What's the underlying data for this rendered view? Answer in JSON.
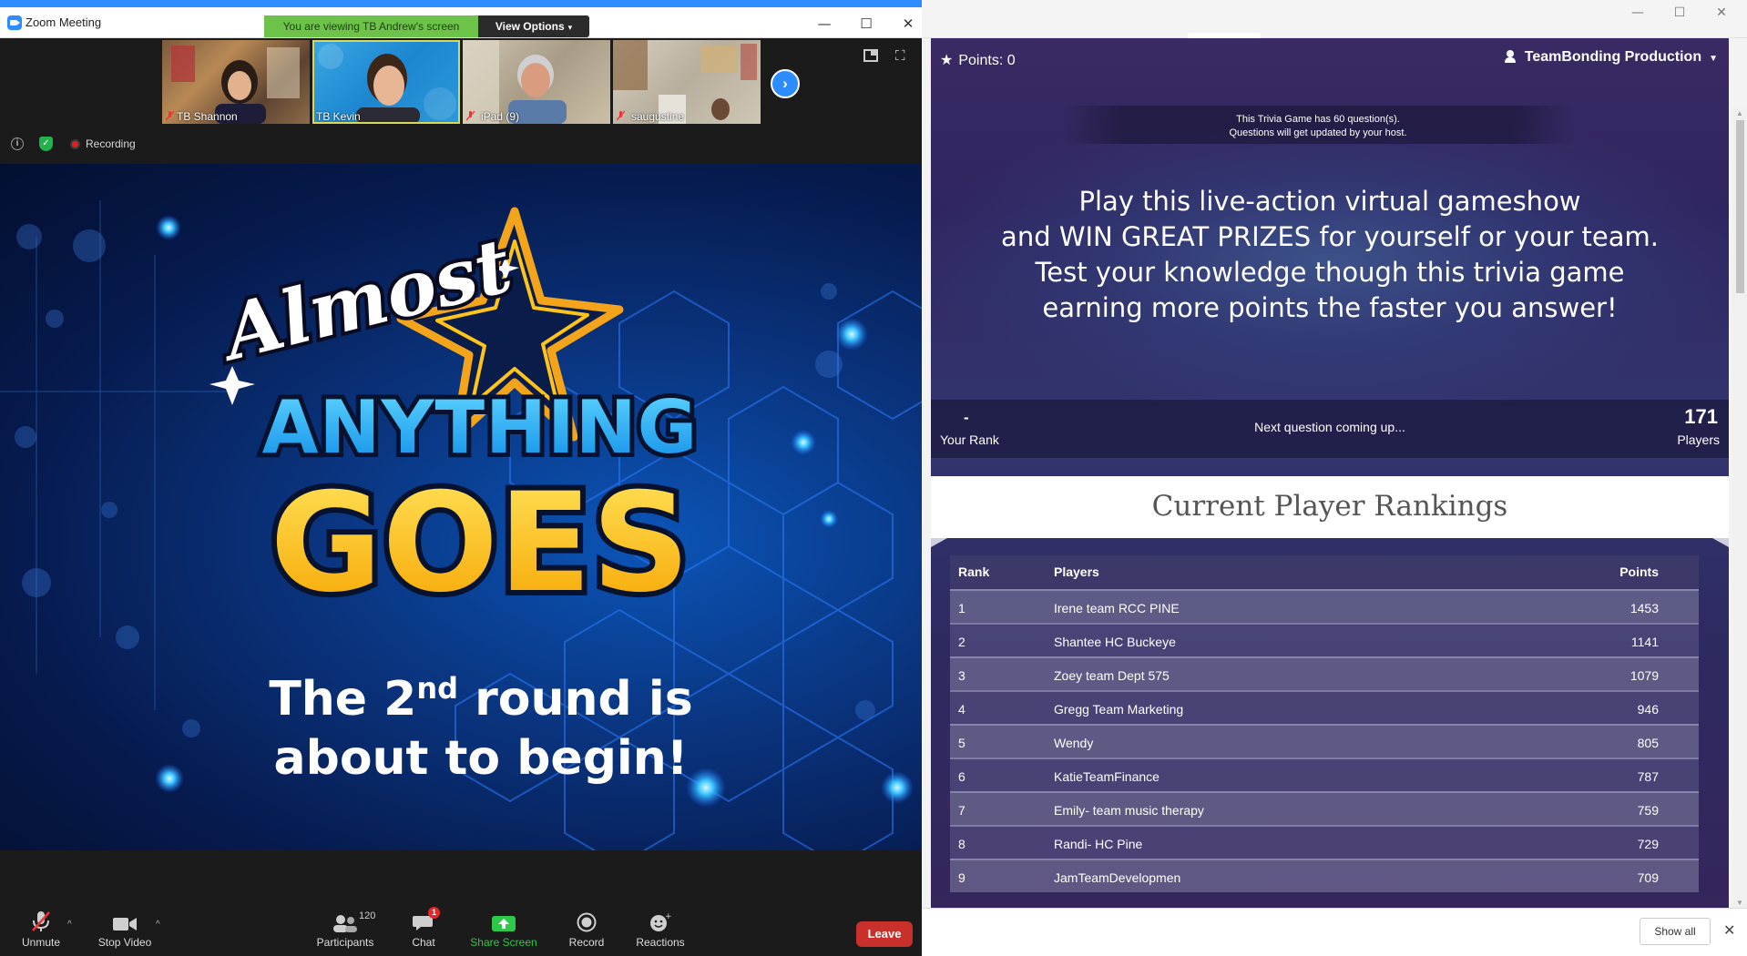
{
  "zoom": {
    "window_title": "Zoom Meeting",
    "viewing_banner": "You are viewing TB Andrew's screen",
    "view_options_label": "View Options",
    "window_controls": {
      "minimize": "—",
      "maximize": "☐",
      "close": "✕"
    },
    "participants": [
      {
        "name": "TB Shannon",
        "muted": true
      },
      {
        "name": "TB Kevin",
        "muted": false,
        "active": true
      },
      {
        "name": "iPad (9)",
        "muted": true
      },
      {
        "name": "saugustine",
        "muted": true
      }
    ],
    "recording_label": "Recording",
    "toolbar": {
      "unmute": "Unmute",
      "stop_video": "Stop Video",
      "participants": "Participants",
      "participants_count": "120",
      "chat": "Chat",
      "chat_badge": "1",
      "share_screen": "Share Screen",
      "record": "Record",
      "reactions": "Reactions",
      "leave": "Leave"
    },
    "shared_slide": {
      "word_almost": "Almost",
      "word_anything": "ANYTHING",
      "word_goes": "GOES",
      "line1_pre": "The 2",
      "line1_sup": "nd",
      "line1_post": " round is",
      "line2": "about to begin!"
    }
  },
  "browser": {
    "window_controls": {
      "minimize": "—",
      "maximize": "☐",
      "close": "✕"
    },
    "points_label": "Points: 0",
    "account_name": "TeamBonding Production",
    "notice_line1": "This Trivia Game has 60 question(s).",
    "notice_line2": "Questions will get updated by your host.",
    "pitch_lines": [
      "Play this live-action virtual gameshow",
      "and WIN GREAT PRIZES for yourself or your team.",
      "Test your knowledge though this trivia game",
      "earning more points the faster you answer!"
    ],
    "your_rank_value": "-",
    "your_rank_label": "Your Rank",
    "next_question": "Next question coming up...",
    "players_value": "171",
    "players_label": "Players",
    "rankings_title": "Current Player Rankings",
    "table": {
      "headers": {
        "rank": "Rank",
        "players": "Players",
        "points": "Points"
      },
      "rows": [
        {
          "rank": "1",
          "name": "Irene team RCC PINE",
          "points": "1453"
        },
        {
          "rank": "2",
          "name": "Shantee HC Buckeye",
          "points": "1141"
        },
        {
          "rank": "3",
          "name": "Zoey team Dept 575",
          "points": "1079"
        },
        {
          "rank": "4",
          "name": "Gregg Team Marketing",
          "points": "946"
        },
        {
          "rank": "5",
          "name": "Wendy",
          "points": "805"
        },
        {
          "rank": "6",
          "name": "KatieTeamFinance",
          "points": "787"
        },
        {
          "rank": "7",
          "name": "Emily- team music therapy",
          "points": "759"
        },
        {
          "rank": "8",
          "name": "Randi- HC Pine",
          "points": "729"
        },
        {
          "rank": "9",
          "name": "JamTeamDevelopmen",
          "points": "709"
        }
      ]
    },
    "show_all_label": "Show all",
    "download_close": "✕"
  },
  "colors": {
    "zoom_blue": "#2d8cff",
    "banner_green": "#6dc34a",
    "leave_red": "#c9302c",
    "share_green": "#2ec84a",
    "slide_cyan": "#22b6ff",
    "slide_yellow": "#ffc41a",
    "star_orange": "#f3a41b"
  }
}
